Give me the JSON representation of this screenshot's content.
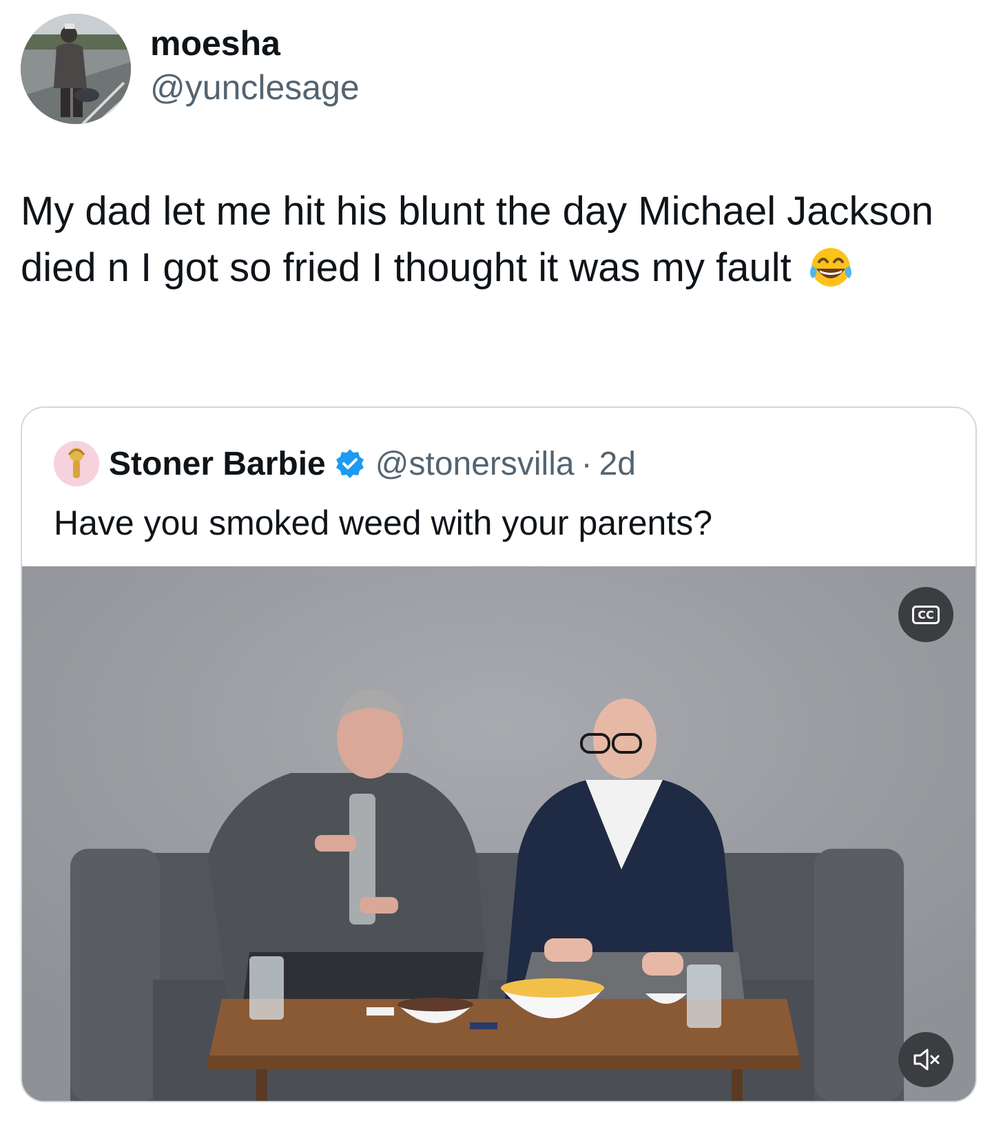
{
  "author": {
    "display_name": "moesha",
    "handle": "@yunclesage"
  },
  "tweet": {
    "text": "My dad let me hit his blunt the day Michael Jackson died n I got so fried I thought it was my fault",
    "emoji": "face-with-tears-of-joy"
  },
  "quoted": {
    "display_name": "Stoner Barbie",
    "verified": true,
    "handle": "@stonersvilla",
    "separator": "·",
    "time": "2d",
    "text": "Have you smoked weed with your parents?",
    "media": {
      "type": "video",
      "captions_label": "CC",
      "muted": true
    }
  },
  "colors": {
    "text_primary": "#0f1419",
    "text_secondary": "#536471",
    "border": "#cfd9de",
    "verified_blue": "#1d9bf0"
  }
}
